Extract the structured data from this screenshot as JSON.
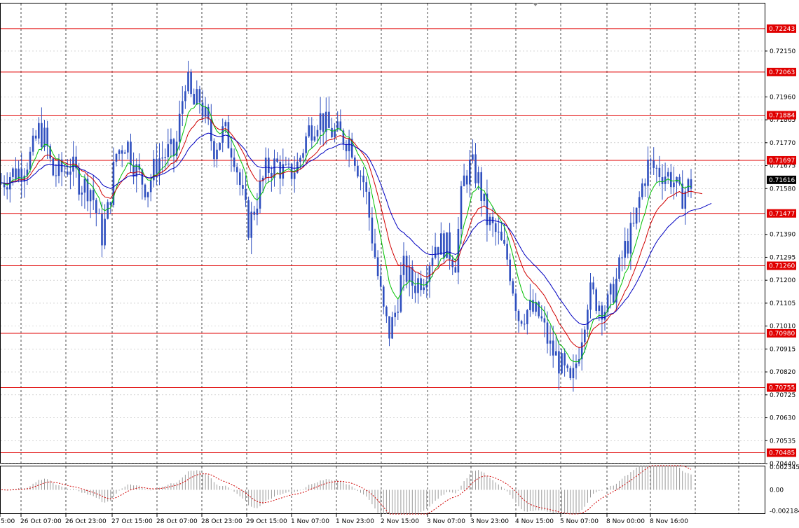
{
  "chart_data": [
    {
      "type": "candlestick",
      "ylim": [
        0.7044,
        0.7235
      ],
      "y_ticks": [
        "0.72150",
        "0.71960",
        "0.71865",
        "0.71770",
        "0.71675",
        "0.71580",
        "0.71390",
        "0.71295",
        "0.71200",
        "0.71105",
        "0.71010",
        "0.70915",
        "0.70820",
        "0.70725",
        "0.70630",
        "0.70535",
        "0.70440"
      ],
      "x_ticks": [
        "5:00",
        "26 Oct 07:00",
        "26 Oct 23:00",
        "27 Oct 15:00",
        "28 Oct 07:00",
        "28 Oct 23:00",
        "29 Oct 15:00",
        "1 Nov 07:00",
        "1 Nov 23:00",
        "2 Nov 15:00",
        "3 Nov 07:00",
        "3 Nov 23:00",
        "4 Nov 15:00",
        "5 Nov 07:00",
        "8 Nov 00:00",
        "8 Nov 16:00"
      ],
      "grid": true,
      "current_price": "0.71616",
      "levels": [
        {
          "value": 0.72243,
          "label": "0.72243"
        },
        {
          "value": 0.72063,
          "label": "0.72063"
        },
        {
          "value": 0.71884,
          "label": "0.71884"
        },
        {
          "value": 0.71697,
          "label": "0.71697"
        },
        {
          "value": 0.71477,
          "label": "0.71477"
        },
        {
          "value": 0.7126,
          "label": "0.71260"
        },
        {
          "value": 0.7098,
          "label": "0.70980"
        },
        {
          "value": 0.70755,
          "label": "0.70755"
        },
        {
          "value": 0.70485,
          "label": "0.70485"
        }
      ],
      "price_path": [
        [
          0,
          0.716
        ],
        [
          15,
          0.7164
        ],
        [
          30,
          0.7166
        ],
        [
          45,
          0.7172
        ],
        [
          55,
          0.7182
        ],
        [
          65,
          0.7178
        ],
        [
          75,
          0.7164
        ],
        [
          90,
          0.7165
        ],
        [
          100,
          0.7168
        ],
        [
          115,
          0.716
        ],
        [
          130,
          0.7158
        ],
        [
          145,
          0.7138
        ],
        [
          155,
          0.715
        ],
        [
          165,
          0.7172
        ],
        [
          180,
          0.7178
        ],
        [
          195,
          0.7165
        ],
        [
          210,
          0.7158
        ],
        [
          225,
          0.717
        ],
        [
          240,
          0.7173
        ],
        [
          250,
          0.7172
        ],
        [
          258,
          0.719
        ],
        [
          265,
          0.7205
        ],
        [
          275,
          0.7192
        ],
        [
          285,
          0.7195
        ],
        [
          295,
          0.7185
        ],
        [
          305,
          0.7175
        ],
        [
          320,
          0.7182
        ],
        [
          335,
          0.7172
        ],
        [
          345,
          0.7155
        ],
        [
          355,
          0.7142
        ],
        [
          365,
          0.7152
        ],
        [
          380,
          0.7166
        ],
        [
          395,
          0.7168
        ],
        [
          410,
          0.7163
        ],
        [
          425,
          0.7168
        ],
        [
          440,
          0.7182
        ],
        [
          455,
          0.7188
        ],
        [
          470,
          0.7182
        ],
        [
          485,
          0.718
        ],
        [
          500,
          0.7178
        ],
        [
          510,
          0.7168
        ],
        [
          520,
          0.716
        ],
        [
          530,
          0.714
        ],
        [
          540,
          0.712
        ],
        [
          548,
          0.7105
        ],
        [
          556,
          0.7098
        ],
        [
          565,
          0.7108
        ],
        [
          575,
          0.7125
        ],
        [
          590,
          0.7118
        ],
        [
          605,
          0.7122
        ],
        [
          620,
          0.7135
        ],
        [
          635,
          0.7135
        ],
        [
          650,
          0.7128
        ],
        [
          660,
          0.716
        ],
        [
          672,
          0.7168
        ],
        [
          682,
          0.7162
        ],
        [
          695,
          0.7145
        ],
        [
          710,
          0.7138
        ],
        [
          725,
          0.7128
        ],
        [
          740,
          0.7105
        ],
        [
          755,
          0.7108
        ],
        [
          770,
          0.7105
        ],
        [
          785,
          0.7092
        ],
        [
          800,
          0.7085
        ],
        [
          815,
          0.7075
        ],
        [
          828,
          0.7095
        ],
        [
          840,
          0.7115
        ],
        [
          850,
          0.7112
        ],
        [
          865,
          0.7108
        ],
        [
          878,
          0.7118
        ],
        [
          890,
          0.7132
        ],
        [
          905,
          0.7142
        ],
        [
          915,
          0.7158
        ],
        [
          925,
          0.7168
        ],
        [
          935,
          0.7166
        ],
        [
          950,
          0.7164
        ],
        [
          960,
          0.7162
        ],
        [
          970,
          0.7154
        ],
        [
          980,
          0.7158
        ],
        [
          990,
          0.7162
        ]
      ],
      "sub_chart": {
        "type": "histogram",
        "y_ticks": [
          "0.002345",
          "0.00",
          "-0.002184"
        ],
        "ylim": [
          -0.0025,
          0.0025
        ]
      },
      "series_colors": {
        "candles": "#2f4fbf",
        "ma_fast": "#00c000",
        "ma_mid": "#d00000",
        "ma_slow": "#0000c0",
        "levels": "#e00000",
        "signal": "#d00000",
        "histogram": "#9a9a9a"
      }
    }
  ]
}
